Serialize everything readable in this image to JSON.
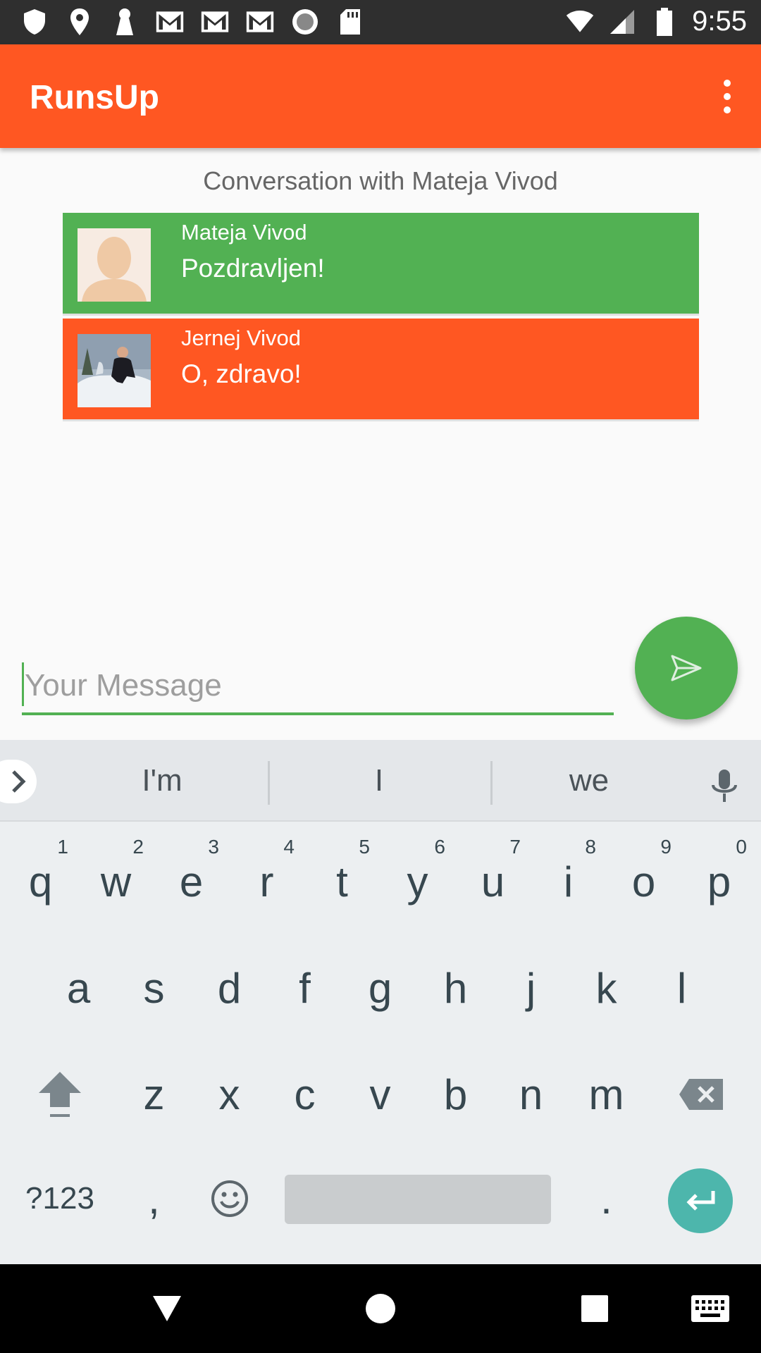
{
  "status_bar": {
    "time": "9:55",
    "icons": [
      "shield-icon",
      "location-icon",
      "keyhole-icon",
      "gmail-icon",
      "gmail-icon",
      "gmail-icon",
      "record-icon",
      "sd-card-icon",
      "wifi-icon",
      "signal-icon",
      "battery-icon"
    ]
  },
  "app_bar": {
    "title": "RunsUp",
    "overflow_icon": "more-vert-icon"
  },
  "conversation": {
    "title": "Conversation with Mateja Vivod",
    "messages": [
      {
        "author": "Mateja Vivod",
        "text": "Pozdravljen!",
        "color": "#52b153",
        "avatar": "default-avatar"
      },
      {
        "author": "Jernej Vivod",
        "text": "O, zdravo!",
        "color": "#ff5722",
        "avatar": "photo-avatar"
      }
    ]
  },
  "composer": {
    "placeholder": "Your Message",
    "value": "",
    "send_icon": "send-icon"
  },
  "keyboard": {
    "suggestions": [
      "I'm",
      "I",
      "we"
    ],
    "row1": [
      {
        "k": "q",
        "h": "1"
      },
      {
        "k": "w",
        "h": "2"
      },
      {
        "k": "e",
        "h": "3"
      },
      {
        "k": "r",
        "h": "4"
      },
      {
        "k": "t",
        "h": "5"
      },
      {
        "k": "y",
        "h": "6"
      },
      {
        "k": "u",
        "h": "7"
      },
      {
        "k": "i",
        "h": "8"
      },
      {
        "k": "o",
        "h": "9"
      },
      {
        "k": "p",
        "h": "0"
      }
    ],
    "row2": [
      "a",
      "s",
      "d",
      "f",
      "g",
      "h",
      "j",
      "k",
      "l"
    ],
    "row3": [
      "z",
      "x",
      "c",
      "v",
      "b",
      "n",
      "m"
    ],
    "symbols_label": "?123",
    "comma": ",",
    "period": "."
  },
  "colors": {
    "accent": "#ff5722",
    "green": "#52b153",
    "enter": "#4db6ac"
  }
}
